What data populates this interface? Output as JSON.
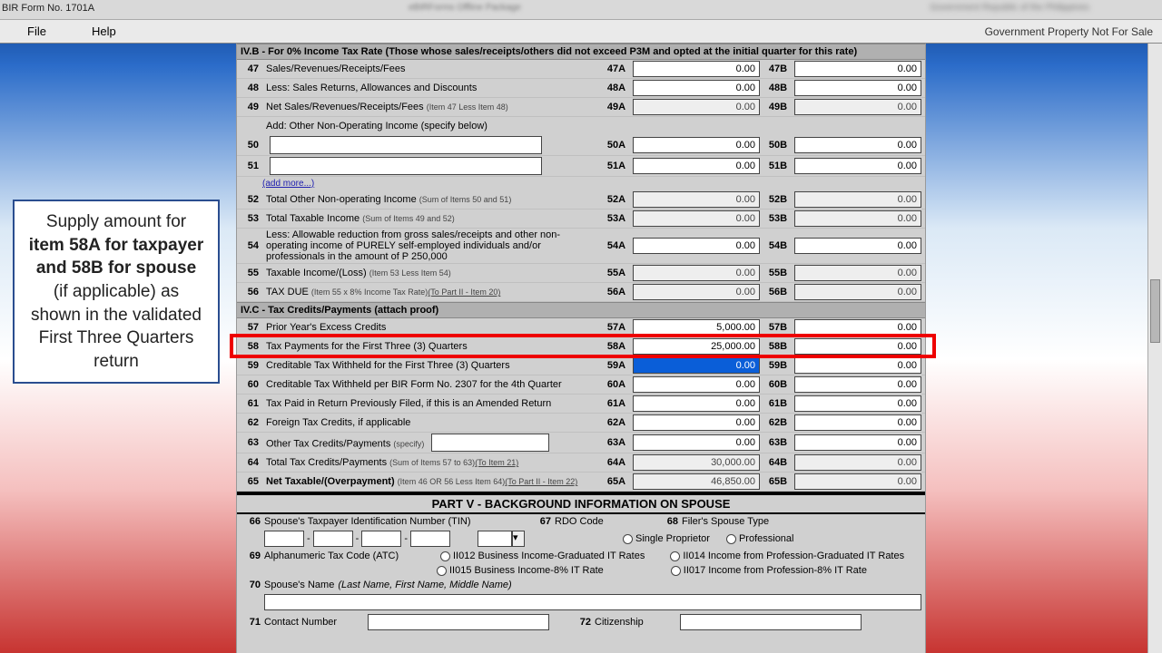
{
  "window": {
    "title": "BIR Form No. 1701A"
  },
  "menu": {
    "file": "File",
    "help": "Help",
    "right": "Government Property Not For Sale"
  },
  "sections": {
    "ivb": "IV.B - For 0% Income Tax Rate (Those whose sales/receipts/others did not exceed P3M and opted at the initial quarter for this rate)",
    "ivc": "IV.C - Tax Credits/Payments (attach proof)",
    "partv": "PART V - BACKGROUND INFORMATION ON SPOUSE"
  },
  "rows": {
    "47": {
      "label": "Sales/Revenues/Receipts/Fees",
      "a": "47A",
      "av": "0.00",
      "b": "47B",
      "bv": "0.00"
    },
    "48": {
      "label": "Less: Sales Returns, Allowances and Discounts",
      "a": "48A",
      "av": "0.00",
      "b": "48B",
      "bv": "0.00"
    },
    "49": {
      "label": "Net Sales/Revenues/Receipts/Fees",
      "note": "(Item 47 Less Item 48)",
      "a": "49A",
      "av": "0.00",
      "b": "49B",
      "bv": "0.00"
    },
    "addnote": "Add: Other Non-Operating Income (specify below)",
    "50": {
      "a": "50A",
      "av": "0.00",
      "b": "50B",
      "bv": "0.00"
    },
    "51": {
      "a": "51A",
      "av": "0.00",
      "b": "51B",
      "bv": "0.00"
    },
    "addmore": "(add more...)",
    "52": {
      "label": "Total Other Non-operating Income",
      "note": "(Sum of Items 50 and 51)",
      "a": "52A",
      "av": "0.00",
      "b": "52B",
      "bv": "0.00"
    },
    "53": {
      "label": "Total Taxable Income",
      "note": "(Sum of Items 49 and 52)",
      "a": "53A",
      "av": "0.00",
      "b": "53B",
      "bv": "0.00"
    },
    "54": {
      "label": "Less: Allowable reduction from gross sales/receipts and other non-operating income of PURELY self-employed individuals and/or professionals in the amount of P 250,000",
      "a": "54A",
      "av": "0.00",
      "b": "54B",
      "bv": "0.00"
    },
    "55": {
      "label": "Taxable Income/(Loss)",
      "note": "(Item 53 Less Item 54)",
      "a": "55A",
      "av": "0.00",
      "b": "55B",
      "bv": "0.00"
    },
    "56": {
      "label": "TAX DUE",
      "note": "(Item 55 x 8% Income Tax Rate)",
      "link": "(To Part II - Item 20)",
      "a": "56A",
      "av": "0.00",
      "b": "56B",
      "bv": "0.00"
    },
    "57": {
      "label": "Prior Year's Excess Credits",
      "a": "57A",
      "av": "5,000.00",
      "b": "57B",
      "bv": "0.00"
    },
    "58": {
      "label": "Tax Payments for the First Three (3) Quarters",
      "a": "58A",
      "av": "25,000.00",
      "b": "58B",
      "bv": "0.00"
    },
    "59": {
      "label": "Creditable Tax Withheld for the First Three (3) Quarters",
      "a": "59A",
      "av": "0.00",
      "b": "59B",
      "bv": "0.00"
    },
    "60": {
      "label": "Creditable Tax Withheld per BIR Form No. 2307 for the 4th Quarter",
      "a": "60A",
      "av": "0.00",
      "b": "60B",
      "bv": "0.00"
    },
    "61": {
      "label": "Tax Paid in Return Previously Filed, if this is an Amended Return",
      "a": "61A",
      "av": "0.00",
      "b": "61B",
      "bv": "0.00"
    },
    "62": {
      "label": "Foreign Tax Credits, if applicable",
      "a": "62A",
      "av": "0.00",
      "b": "62B",
      "bv": "0.00"
    },
    "63": {
      "label": "Other Tax Credits/Payments",
      "note": "(specify)",
      "a": "63A",
      "av": "0.00",
      "b": "63B",
      "bv": "0.00"
    },
    "64": {
      "label": "Total Tax Credits/Payments",
      "note": "(Sum of Items 57 to 63)",
      "link": "(To Item 21)",
      "a": "64A",
      "av": "30,000.00",
      "b": "64B",
      "bv": "0.00"
    },
    "65": {
      "label": "Net Taxable/(Overpayment)",
      "note": "(Item 46 OR 56 Less Item 64)",
      "link": "(To Part II - Item 22)",
      "a": "65A",
      "av": "46,850.00",
      "b": "65B",
      "bv": "0.00"
    }
  },
  "spouse": {
    "66": "Spouse's Taxpayer Identification Number (TIN)",
    "67": "RDO Code",
    "68": "Filer's Spouse Type",
    "68a": "Single Proprietor",
    "68b": "Professional",
    "69": "Alphanumeric Tax Code (ATC)",
    "atc": {
      "a": "II012 Business Income-Graduated IT Rates",
      "b": "II014 Income from Profession-Graduated IT Rates",
      "c": "II015 Business Income-8% IT Rate",
      "d": "II017 Income from Profession-8% IT Rate"
    },
    "70": "Spouse's Name",
    "70note": "(Last Name, First Name, Middle Name)",
    "71": "Contact Number",
    "72": "Citizenship"
  },
  "callout": {
    "l1": "Supply amount for",
    "l2a": "item 58A for taxpayer and 58B for spouse",
    "l2b": " (if applicable) as shown in the validated First Three Quarters return"
  }
}
